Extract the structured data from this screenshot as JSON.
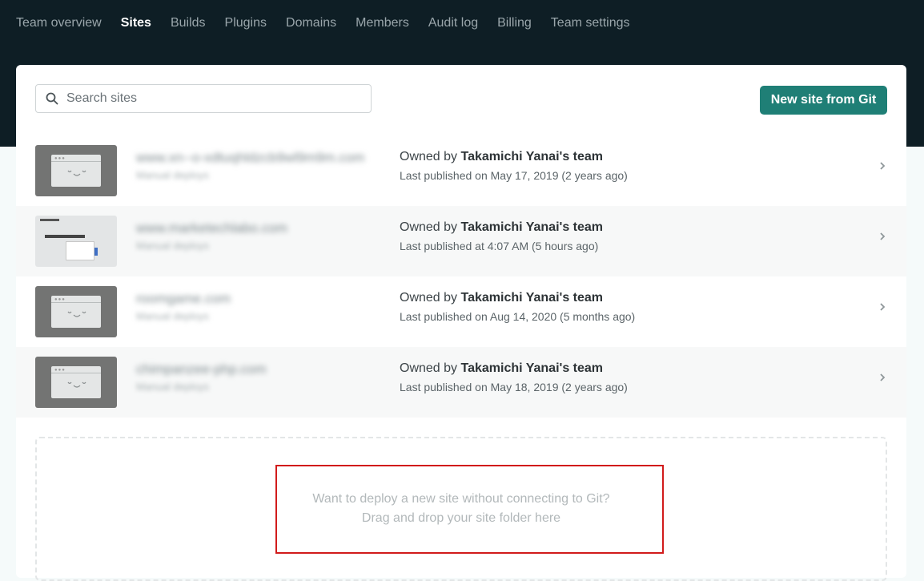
{
  "nav": {
    "items": [
      {
        "label": "Team overview",
        "active": false
      },
      {
        "label": "Sites",
        "active": true
      },
      {
        "label": "Builds",
        "active": false
      },
      {
        "label": "Plugins",
        "active": false
      },
      {
        "label": "Domains",
        "active": false
      },
      {
        "label": "Members",
        "active": false
      },
      {
        "label": "Audit log",
        "active": false
      },
      {
        "label": "Billing",
        "active": false
      },
      {
        "label": "Team settings",
        "active": false
      }
    ]
  },
  "search": {
    "placeholder": "Search sites",
    "value": ""
  },
  "new_site_button": "New site from Git",
  "sites": [
    {
      "name": "www.xn--o-xdtuqhldzcb9wl9m9m.com",
      "deploy_type": "Manual deploys",
      "owner_prefix": "Owned by ",
      "owner": "Takamichi Yanai's team",
      "published": "Last published on May 17, 2019 (2 years ago)",
      "thumb": "placeholder"
    },
    {
      "name": "www.marketechlabo.com",
      "deploy_type": "Manual deploys",
      "owner_prefix": "Owned by ",
      "owner": "Takamichi Yanai's team",
      "published": "Last published at 4:07 AM (5 hours ago)",
      "thumb": "screenshot"
    },
    {
      "name": "roomgame.com",
      "deploy_type": "Manual deploys",
      "owner_prefix": "Owned by ",
      "owner": "Takamichi Yanai's team",
      "published": "Last published on Aug 14, 2020 (5 months ago)",
      "thumb": "placeholder"
    },
    {
      "name": "chimpanzee-php.com",
      "deploy_type": "Manual deploys",
      "owner_prefix": "Owned by ",
      "owner": "Takamichi Yanai's team",
      "published": "Last published on May 18, 2019 (2 years ago)",
      "thumb": "placeholder"
    }
  ],
  "dropzone": {
    "line1": "Want to deploy a new site without connecting to Git?",
    "line2": "Drag and drop your site folder here"
  },
  "colors": {
    "topbar": "#0e1e25",
    "accent": "#1f7f76",
    "highlight": "#d11b1b"
  },
  "icons": {
    "search": "search-icon",
    "chevron": "chevron-right-icon",
    "thumb_face": "smiley-window-icon"
  }
}
